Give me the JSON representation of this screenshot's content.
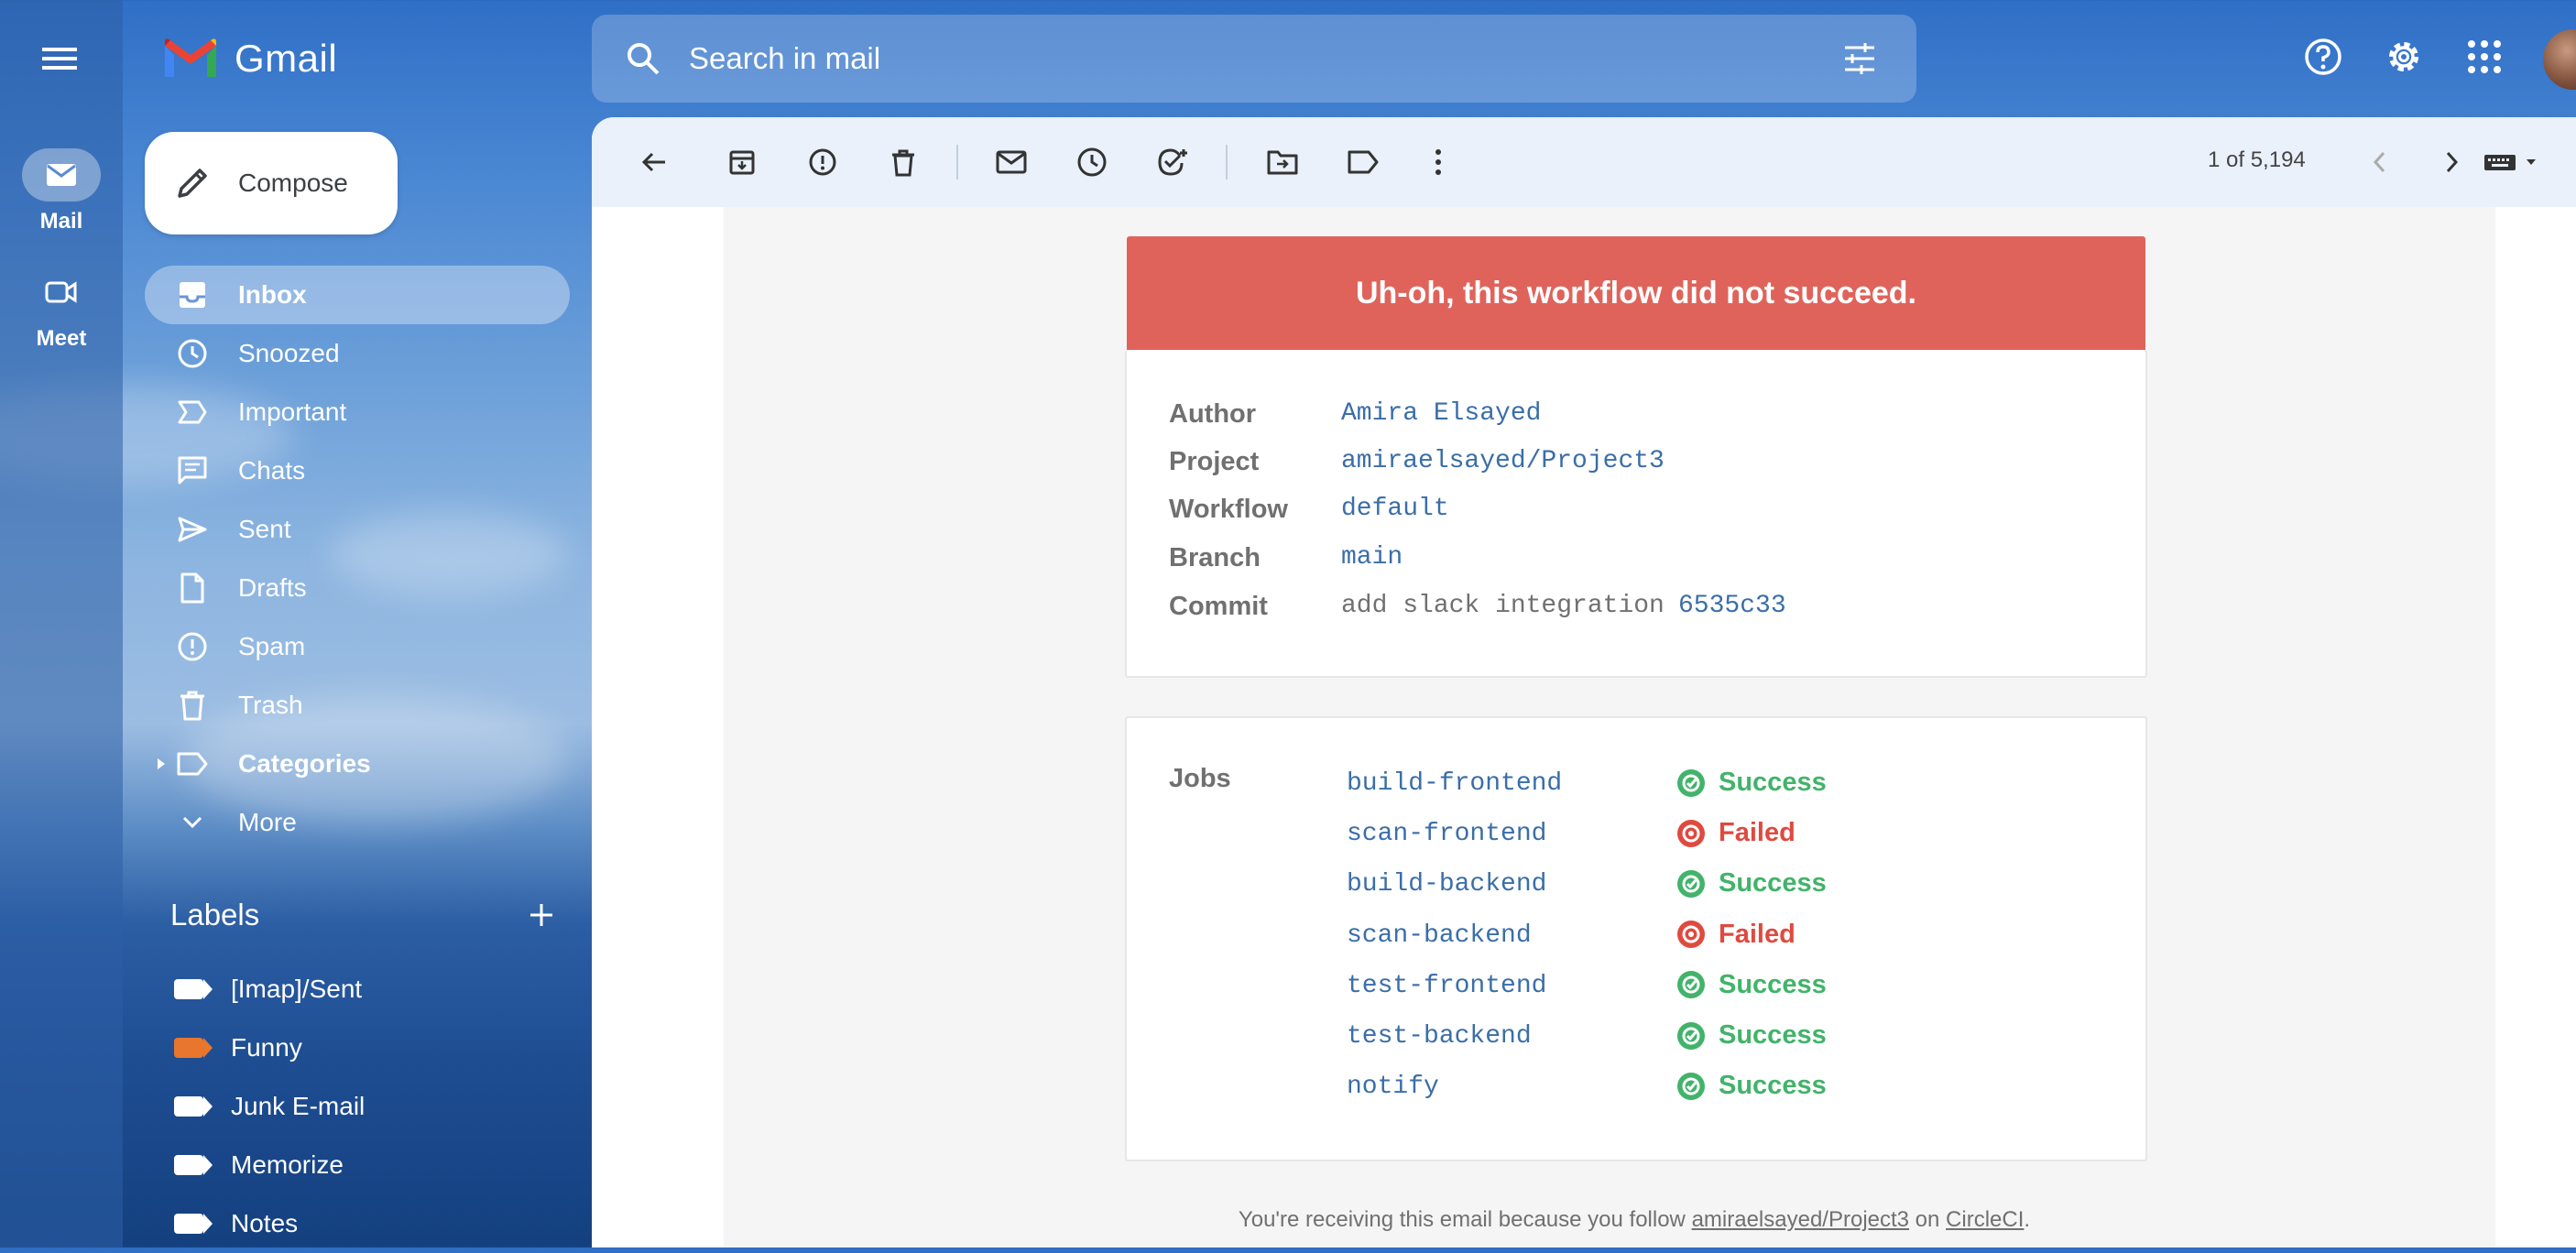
{
  "app": {
    "name": "Gmail"
  },
  "rail": {
    "items": [
      {
        "label": "Mail",
        "icon": "mail-icon",
        "active": true
      },
      {
        "label": "Meet",
        "icon": "video-icon",
        "active": false
      }
    ]
  },
  "search": {
    "placeholder": "Search in mail"
  },
  "compose": {
    "label": "Compose"
  },
  "nav": {
    "items": [
      {
        "label": "Inbox",
        "icon": "inbox-icon"
      },
      {
        "label": "Snoozed",
        "icon": "clock-icon"
      },
      {
        "label": "Important",
        "icon": "important-icon"
      },
      {
        "label": "Chats",
        "icon": "chat-icon"
      },
      {
        "label": "Sent",
        "icon": "send-icon"
      },
      {
        "label": "Drafts",
        "icon": "draft-icon"
      },
      {
        "label": "Spam",
        "icon": "spam-icon"
      },
      {
        "label": "Trash",
        "icon": "trash-icon"
      },
      {
        "label": "Categories",
        "icon": "label-icon"
      },
      {
        "label": "More",
        "icon": "chevron-down-icon"
      }
    ]
  },
  "labels": {
    "heading": "Labels",
    "items": [
      {
        "label": "[Imap]/Sent",
        "color": "#ffffff"
      },
      {
        "label": "Funny",
        "color": "#e8762d"
      },
      {
        "label": "Junk E-mail",
        "color": "#ffffff"
      },
      {
        "label": "Memorize",
        "color": "#ffffff"
      },
      {
        "label": "Notes",
        "color": "#ffffff"
      }
    ]
  },
  "toolbar": {
    "pager": "1 of 5,194"
  },
  "email": {
    "banner": "Uh-oh, this workflow did not succeed.",
    "details": {
      "author_key": "Author",
      "author_val": "Amira Elsayed",
      "project_key": "Project",
      "project_val": "amiraelsayed/Project3",
      "workflow_key": "Workflow",
      "workflow_val": "default",
      "branch_key": "Branch",
      "branch_val": "main",
      "commit_key": "Commit",
      "commit_msg": "add slack integration",
      "commit_hash": "6535c33"
    },
    "jobs_label": "Jobs",
    "jobs": [
      {
        "name": "build-frontend",
        "status": "Success"
      },
      {
        "name": "scan-frontend",
        "status": "Failed"
      },
      {
        "name": "build-backend",
        "status": "Success"
      },
      {
        "name": "scan-backend",
        "status": "Failed"
      },
      {
        "name": "test-frontend",
        "status": "Success"
      },
      {
        "name": "test-backend",
        "status": "Success"
      },
      {
        "name": "notify",
        "status": "Success"
      }
    ],
    "footer": {
      "pre": "You're receiving this email because you follow ",
      "project_link": "amiraelsayed/Project3",
      "mid": " on ",
      "site_link": "CircleCI",
      "post": "."
    }
  },
  "colors": {
    "success": "#42b36a",
    "failed": "#df4a3f",
    "banner": "#e0635b",
    "link": "#3a6ea8"
  }
}
